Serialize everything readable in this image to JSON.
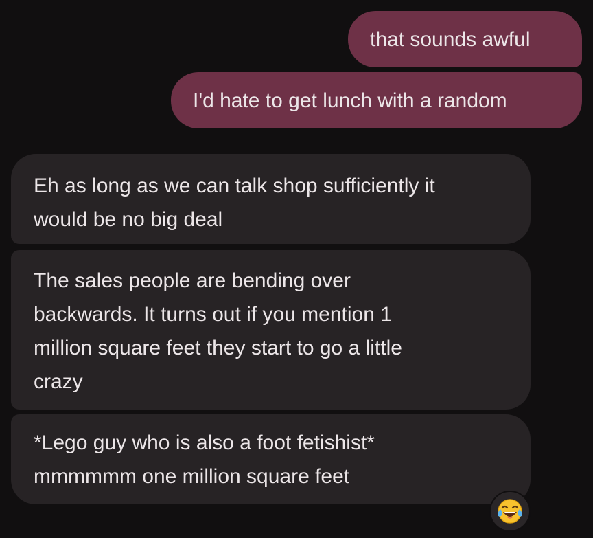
{
  "messages": [
    {
      "direction": "sent",
      "lines": [
        "that sounds awful"
      ]
    },
    {
      "direction": "sent",
      "lines": [
        "I'd hate to get lunch with a random"
      ]
    },
    {
      "direction": "received",
      "lines": [
        "Eh as long as we can talk shop sufficiently it",
        "would be no big deal"
      ]
    },
    {
      "direction": "received",
      "lines": [
        "The sales people are bending over",
        "backwards. It turns out if you mention 1",
        "million square feet they start to go a little",
        "crazy"
      ]
    },
    {
      "direction": "received",
      "lines": [
        "*Lego guy who is also a foot fetishist*",
        "mmmmmm one million square feet"
      ]
    }
  ],
  "reaction": {
    "icon": "face-with-tears-of-joy-icon",
    "emoji": "😂"
  },
  "colors": {
    "background": "#110f10",
    "sent_bubble": "#6e3147",
    "received_bubble": "#272325",
    "text": "#ece6e8"
  }
}
